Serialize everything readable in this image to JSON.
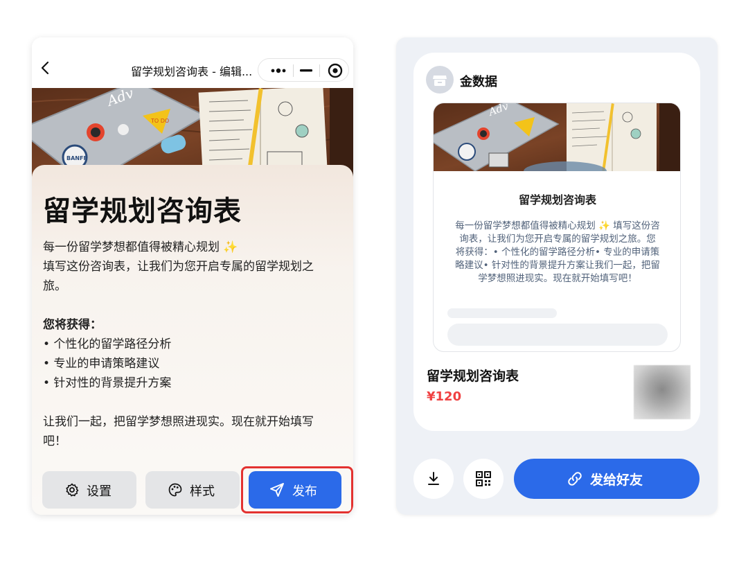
{
  "left_phone": {
    "topbar_title": "留学规划咨询表 - 编辑...",
    "heading": "留学规划咨询表",
    "intro_line1": "每一份留学梦想都值得被精心规划",
    "intro_sparkle": "✨",
    "intro_line2": "填写这份咨询表，让我们为您开启专属的留学规划之",
    "intro_line3": "旅。",
    "benefits_title": "您将获得：",
    "benefits": [
      "• 个性化的留学路径分析",
      "• 专业的申请策略建议",
      "• 针对性的背景提升方案"
    ],
    "outro_line1": "让我们一起，把留学梦想照进现实。现在就开始填写",
    "outro_line2": "吧！",
    "buttons": {
      "settings": "设置",
      "style": "样式",
      "publish": "发布"
    }
  },
  "right_panel": {
    "brand_name": "金数据",
    "preview_title": "留学规划咨询表",
    "preview_desc_lines": [
      "每一份留学梦想都值得被精心规划 ✨ 填写这份咨",
      "询表，让我们为您开启专属的留学规划之旅。您",
      "将获得：• 个性化的留学路径分析• 专业的申请策",
      "略建议• 针对性的背景提升方案让我们一起，把留",
      "学梦想照进现实。现在就开始填写吧！"
    ],
    "product_title": "留学规划咨询表",
    "price": "¥120",
    "send_label": "发给好友"
  },
  "colors": {
    "accent": "#2b6ae9",
    "highlight": "#e33230",
    "price": "#f04142"
  },
  "icons": [
    "back-icon",
    "more-icon",
    "minimize-icon",
    "close-target-icon",
    "gear-icon",
    "palette-icon",
    "send-icon",
    "download-icon",
    "qrcode-icon",
    "link-icon"
  ]
}
